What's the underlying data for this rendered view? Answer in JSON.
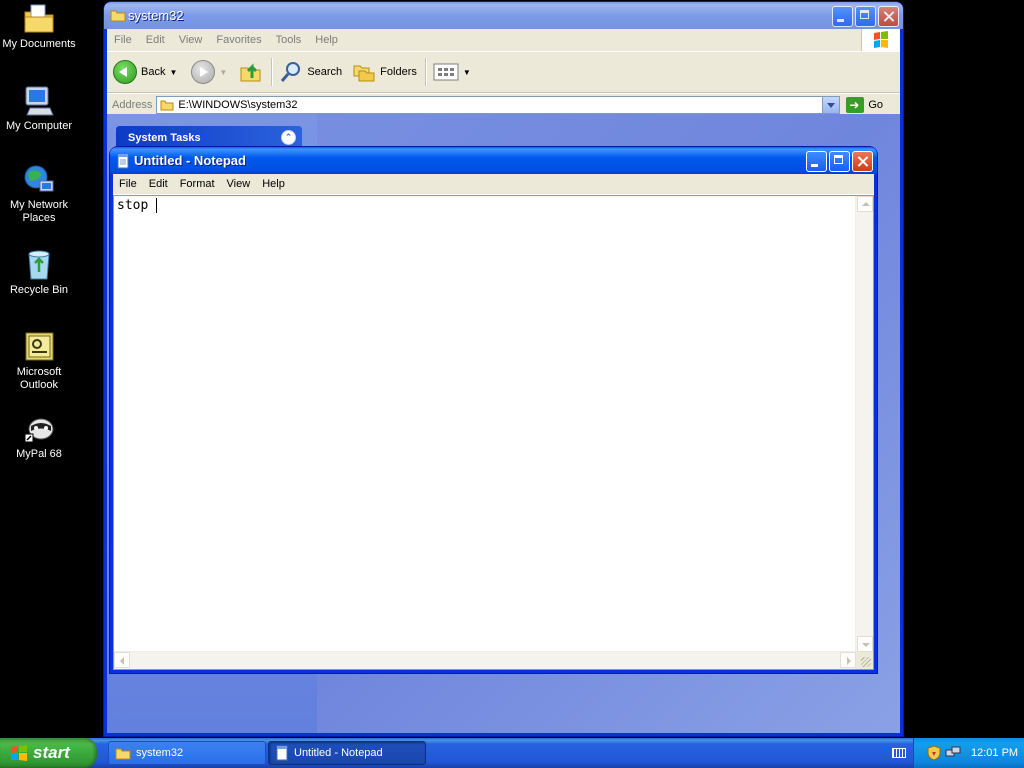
{
  "desktop": {
    "icons": [
      {
        "label": "My Documents",
        "icon": "my-documents-icon"
      },
      {
        "label": "My Computer",
        "icon": "my-computer-icon"
      },
      {
        "label": "My Network\nPlaces",
        "icon": "network-places-icon"
      },
      {
        "label": "Recycle Bin",
        "icon": "recycle-bin-icon"
      },
      {
        "label": "Microsoft\nOutlook",
        "icon": "outlook-icon"
      },
      {
        "label": "MyPal 68",
        "icon": "mypal-icon"
      }
    ]
  },
  "explorer": {
    "title": "system32",
    "menu": [
      "File",
      "Edit",
      "View",
      "Favorites",
      "Tools",
      "Help"
    ],
    "toolbar": {
      "back_label": "Back",
      "search_label": "Search",
      "folders_label": "Folders"
    },
    "address": {
      "label": "Address",
      "value": "E:\\WINDOWS\\system32",
      "go_label": "Go"
    },
    "task_pane_title": "System Tasks"
  },
  "notepad": {
    "title": "Untitled - Notepad",
    "menu": [
      "File",
      "Edit",
      "Format",
      "View",
      "Help"
    ],
    "content": "stop "
  },
  "taskbar": {
    "start_label": "start",
    "tasks": [
      {
        "label": "system32",
        "active": false
      },
      {
        "label": "Untitled - Notepad",
        "active": true
      }
    ],
    "clock": "12:01 PM"
  },
  "colors": {
    "xp_blue": "#0831d9",
    "titlebar": "#0058ee",
    "start_green": "#3c9a3c",
    "tray": "#0e86e0"
  }
}
